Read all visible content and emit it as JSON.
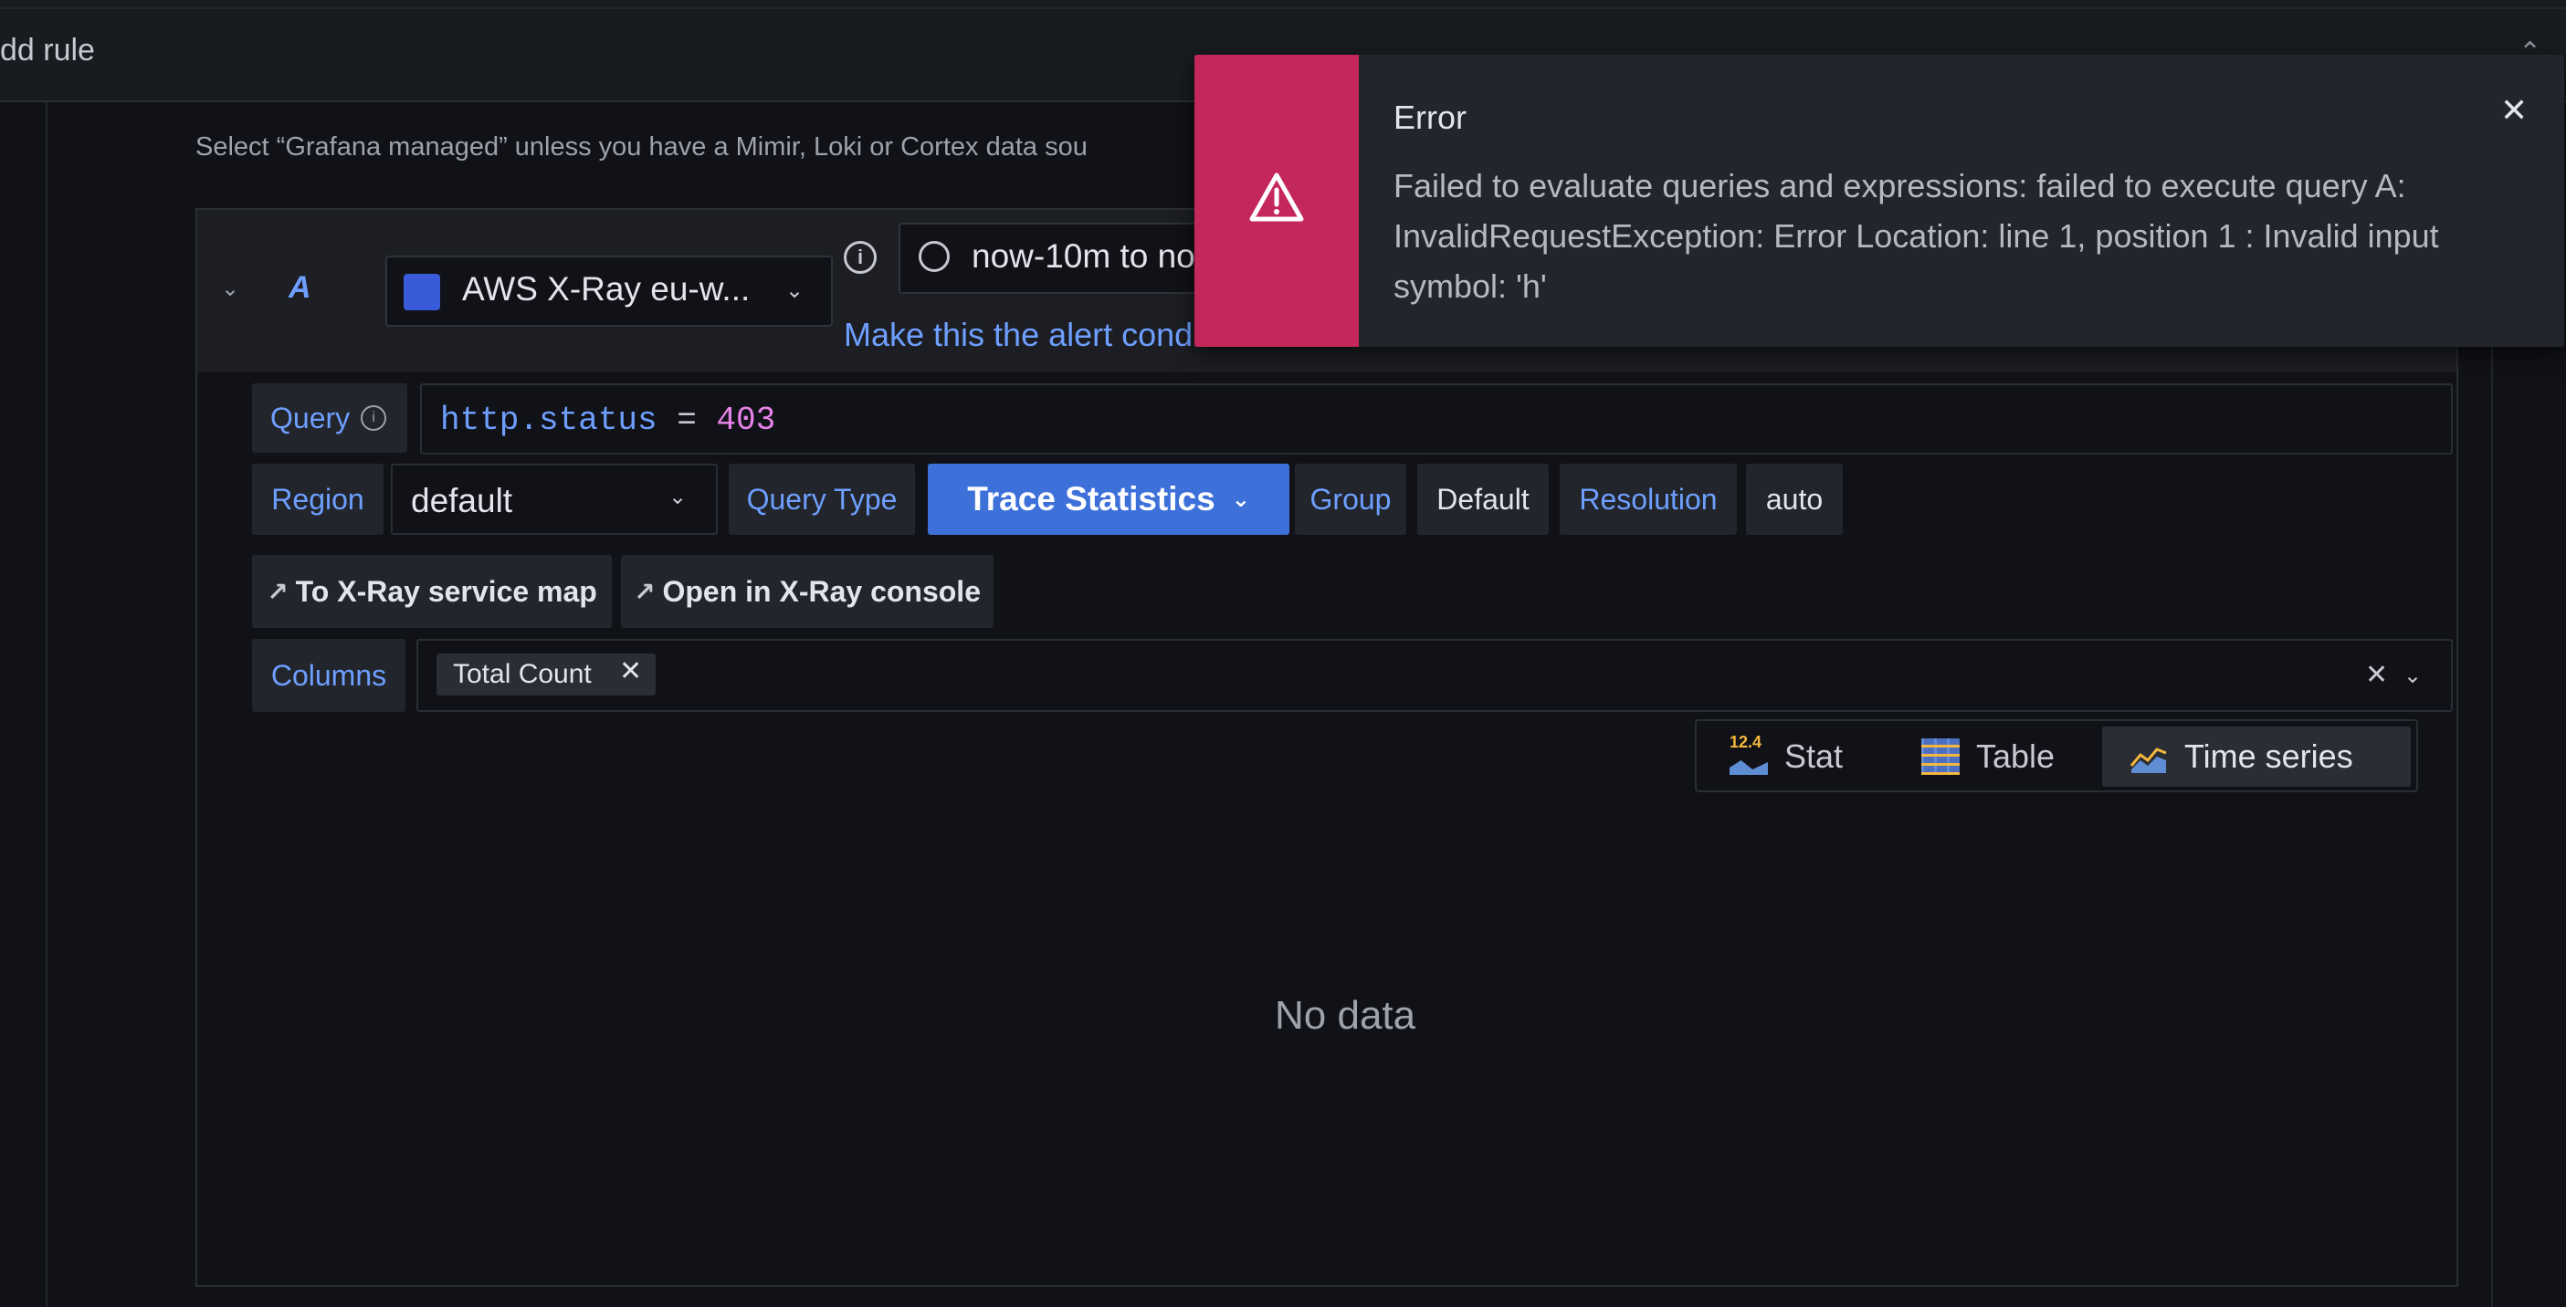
{
  "header": {
    "title": "dd rule"
  },
  "description": "Select “Grafana managed” unless you have a Mimir, Loki or Cortex data sou",
  "query_row": {
    "ref_id": "A",
    "datasource": "AWS X-Ray eu-w...",
    "time_range": "now-10m to no",
    "alert_condition_link": "Make this the alert condition"
  },
  "editor": {
    "query_label": "Query",
    "query_field": "http.status",
    "query_op": " = ",
    "query_value": "403",
    "region_label": "Region",
    "region_value": "default",
    "query_type_label": "Query Type",
    "query_type_value": "Trace Statistics",
    "group_label": "Group",
    "group_value": "Default",
    "resolution_label": "Resolution",
    "resolution_value": "auto",
    "service_map_link": "To X-Ray service map",
    "console_link": "Open in X-Ray console",
    "columns_label": "Columns",
    "column_chip": "Total Count"
  },
  "viz": {
    "stat_label": "Stat",
    "stat_icon_number": "12.4",
    "table_label": "Table",
    "timeseries_label": "Time series",
    "selected": "Time series"
  },
  "preview": {
    "empty_text": "No data"
  },
  "toast": {
    "title": "Error",
    "message": "Failed to evaluate queries and expressions: failed to execute query A: InvalidRequestException: Error Location: line 1, position 1 : Invalid input symbol: 'h'",
    "color": "#c4285a"
  },
  "colors": {
    "accent": "#6e9fff",
    "primary_button": "#3d71d9",
    "background": "#111217"
  }
}
